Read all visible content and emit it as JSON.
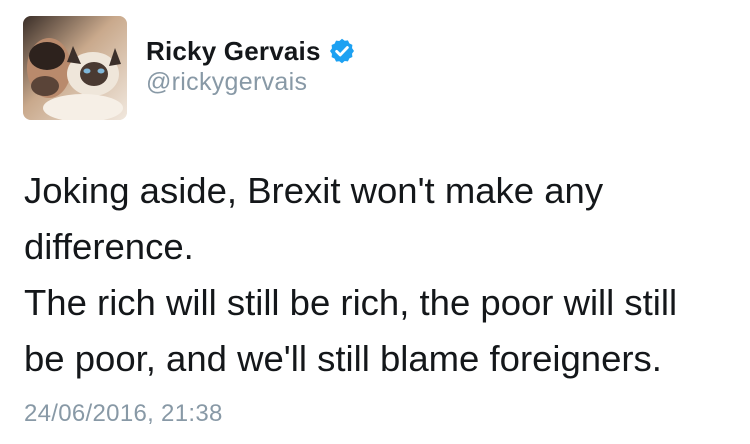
{
  "tweet": {
    "author": {
      "display_name": "Ricky Gervais",
      "handle": "@rickygervais",
      "verified": true,
      "avatar_icon": "profile-photo-cat",
      "verified_icon": "verified-badge-icon",
      "verified_color": "#1da1f2"
    },
    "text_lines": [
      "Joking aside, Brexit won't make any",
      "difference.",
      "The rich will still be rich, the poor will still",
      "be poor, and we'll still blame foreigners."
    ],
    "timestamp": "24/06/2016, 21:38"
  },
  "colors": {
    "text": "#14171a",
    "secondary_text": "#8899a6",
    "background": "#ffffff"
  }
}
